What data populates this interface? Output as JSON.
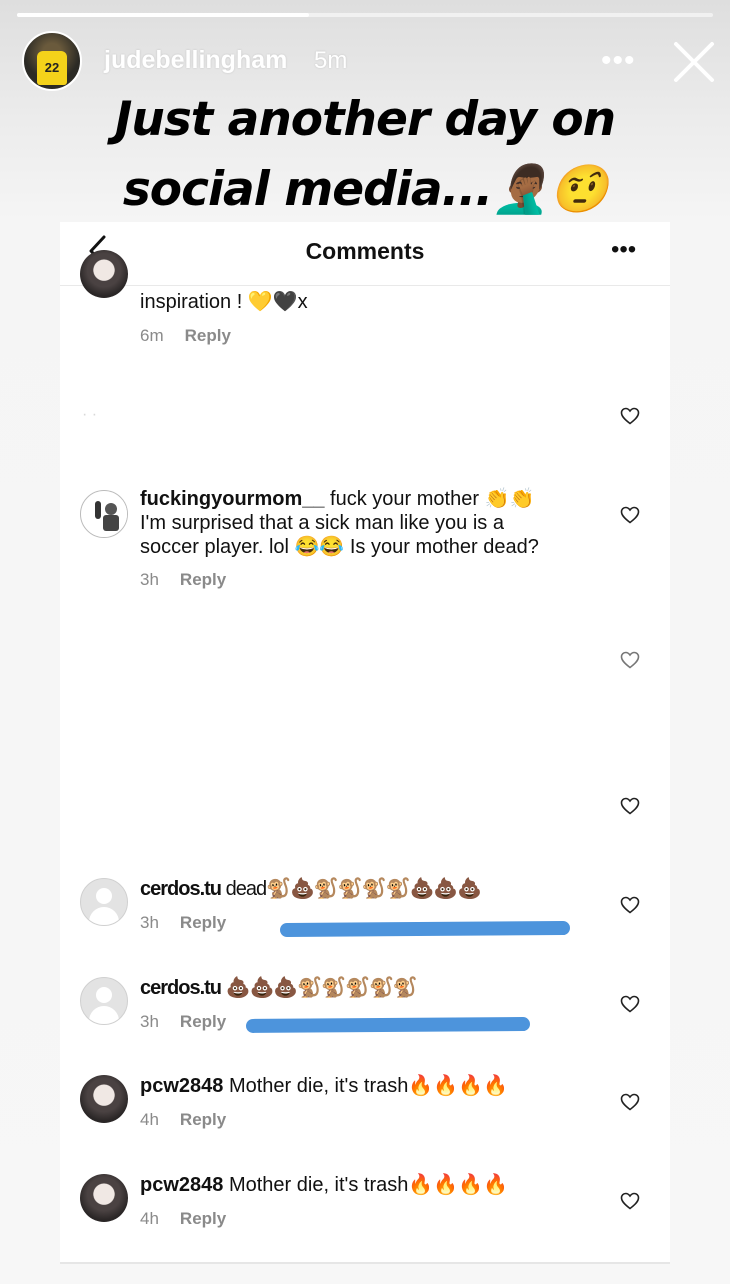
{
  "story": {
    "progress": 0.42,
    "username": "judebellingham",
    "time_ago": "5m",
    "jersey_number": "22",
    "more_glyph": "•••",
    "caption_line1": "Just another day on",
    "caption_line2": "social media...🤦🏾‍♂️🤨"
  },
  "comments_header": {
    "title": "Comments",
    "more_glyph": "•••"
  },
  "comments": [
    {
      "text": "inspiration ! 💛🖤x",
      "time": "6m",
      "reply": "Reply"
    },
    {
      "username": "fuckingyourmom__",
      "text_line1": " fuck your mother 👏👏",
      "text_line2": "I'm surprised that a sick man like you is a",
      "text_line3": "soccer player. lol 😂😂 Is your mother dead?",
      "time": "3h",
      "reply": "Reply"
    },
    {
      "username": "cerdos.tu",
      "text": " dead🐒💩🐒🐒🐒🐒💩💩💩",
      "time": "3h",
      "reply": "Reply"
    },
    {
      "username": "cerdos.tu",
      "text": " 💩💩💩🐒🐒🐒🐒🐒",
      "time": "3h",
      "reply": "Reply"
    },
    {
      "username": "pcw2848",
      "text": " Mother die, it's trash🔥🔥🔥🔥",
      "time": "4h",
      "reply": "Reply"
    },
    {
      "username": "pcw2848",
      "text": " Mother die, it's trash🔥🔥🔥🔥",
      "time": "4h",
      "reply": "Reply"
    }
  ],
  "colors": {
    "scribble": "#4d94dc",
    "meta_gray": "#8a8a8a"
  },
  "icons": [
    "back-chevron-icon",
    "more-icon",
    "close-icon",
    "heart-icon",
    "avatar-placeholder-icon"
  ]
}
